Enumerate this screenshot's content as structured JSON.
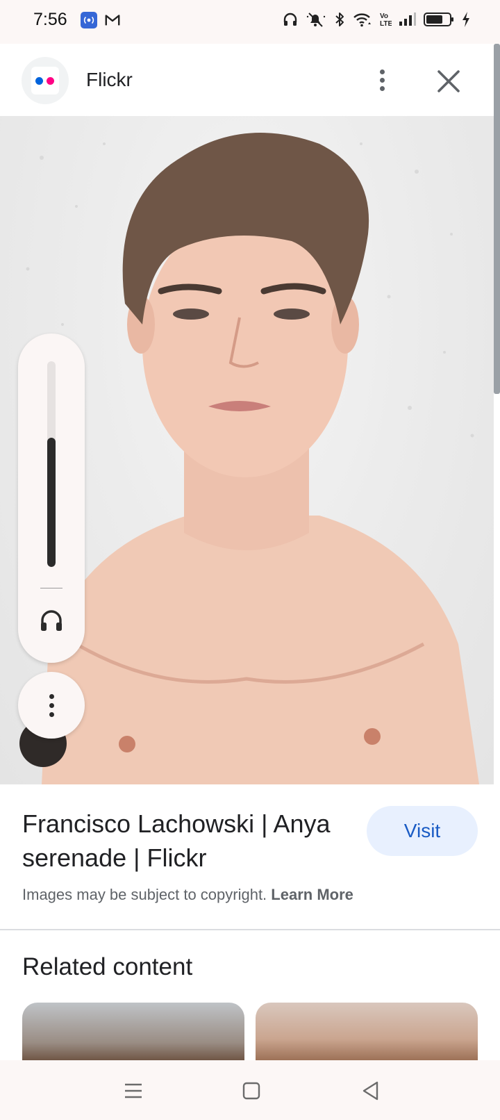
{
  "status_bar": {
    "time": "7:56",
    "icons": [
      "hotspot-icon",
      "gmail-icon",
      "headphones-icon",
      "mute-icon",
      "bluetooth-icon",
      "wifi-icon",
      "volte-icon",
      "signal-icon",
      "battery-icon",
      "charging-icon"
    ],
    "volte_label": "Vo\nLTE"
  },
  "header": {
    "site_name": "Flickr",
    "logo_colors": [
      "#0063dc",
      "#ff0084"
    ]
  },
  "volume": {
    "level_fraction": 0.63
  },
  "info": {
    "title": "Francisco Lachowski | Anya serenade | Flickr",
    "visit_label": "Visit",
    "copyright_text": "Images may be subject to copyright.",
    "learn_more": "Learn More"
  },
  "related": {
    "title": "Related content"
  },
  "colors": {
    "accent": "#1a5bc4",
    "visit_bg": "#e8f0fe",
    "status_bg": "#fcf7f6"
  }
}
